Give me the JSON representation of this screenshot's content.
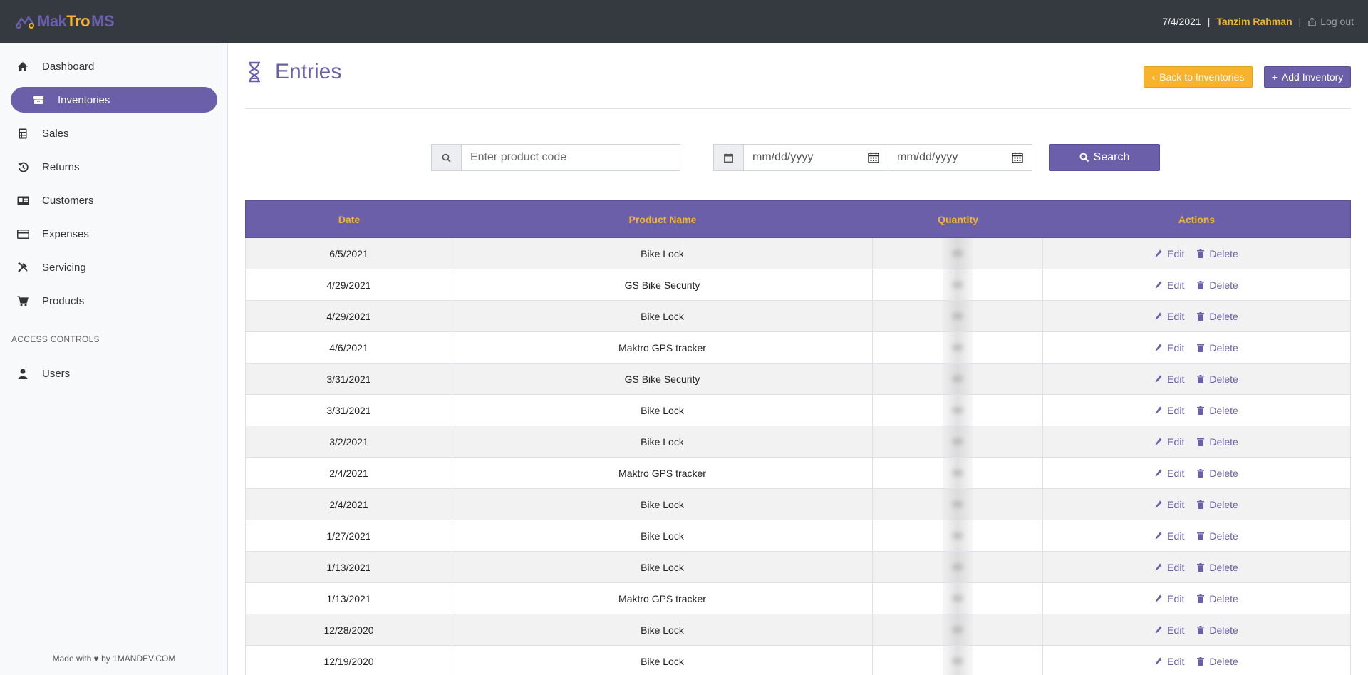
{
  "header": {
    "logo_mak": "Mak",
    "logo_tro": "Tro",
    "logo_ms": "MS",
    "date": "7/4/2021",
    "separator": "|",
    "user_name": "Tanzim Rahman",
    "logout_label": "Log out"
  },
  "sidebar": {
    "items": [
      {
        "label": "Dashboard",
        "icon": "home-icon"
      },
      {
        "label": "Inventories",
        "icon": "box-icon"
      },
      {
        "label": "Sales",
        "icon": "calculator-icon"
      },
      {
        "label": "Returns",
        "icon": "history-icon"
      },
      {
        "label": "Customers",
        "icon": "id-card-icon"
      },
      {
        "label": "Expenses",
        "icon": "credit-card-icon"
      },
      {
        "label": "Servicing",
        "icon": "tools-icon"
      },
      {
        "label": "Products",
        "icon": "cart-icon"
      }
    ],
    "section_label": "ACCESS CONTROLS",
    "users_label": "Users",
    "footer": "Made with ♥ by 1MANDEV.COM"
  },
  "page": {
    "title": "Entries",
    "back_button": "Back to Inventories",
    "add_button": "Add Inventory"
  },
  "search": {
    "product_placeholder": "Enter product code",
    "date_from_placeholder": "mm/dd/yyyy",
    "date_to_placeholder": "mm/dd/yyyy",
    "button_label": "Search"
  },
  "table": {
    "headers": [
      "Date",
      "Product Name",
      "Quantity",
      "Actions"
    ],
    "edit_label": "Edit",
    "delete_label": "Delete",
    "rows": [
      {
        "date": "6/5/2021",
        "product": "Bike Lock"
      },
      {
        "date": "4/29/2021",
        "product": "GS Bike Security"
      },
      {
        "date": "4/29/2021",
        "product": "Bike Lock"
      },
      {
        "date": "4/6/2021",
        "product": "Maktro GPS tracker"
      },
      {
        "date": "3/31/2021",
        "product": "GS Bike Security"
      },
      {
        "date": "3/31/2021",
        "product": "Bike Lock"
      },
      {
        "date": "3/2/2021",
        "product": "Bike Lock"
      },
      {
        "date": "2/4/2021",
        "product": "Maktro GPS tracker"
      },
      {
        "date": "2/4/2021",
        "product": "Bike Lock"
      },
      {
        "date": "1/27/2021",
        "product": "Bike Lock"
      },
      {
        "date": "1/13/2021",
        "product": "Bike Lock"
      },
      {
        "date": "1/13/2021",
        "product": "Maktro GPS tracker"
      },
      {
        "date": "12/28/2020",
        "product": "Bike Lock"
      },
      {
        "date": "12/19/2020",
        "product": "Bike Lock"
      }
    ]
  },
  "colors": {
    "primary": "#6c5fa9",
    "accent": "#f7b32b",
    "topbar": "#343a40"
  }
}
